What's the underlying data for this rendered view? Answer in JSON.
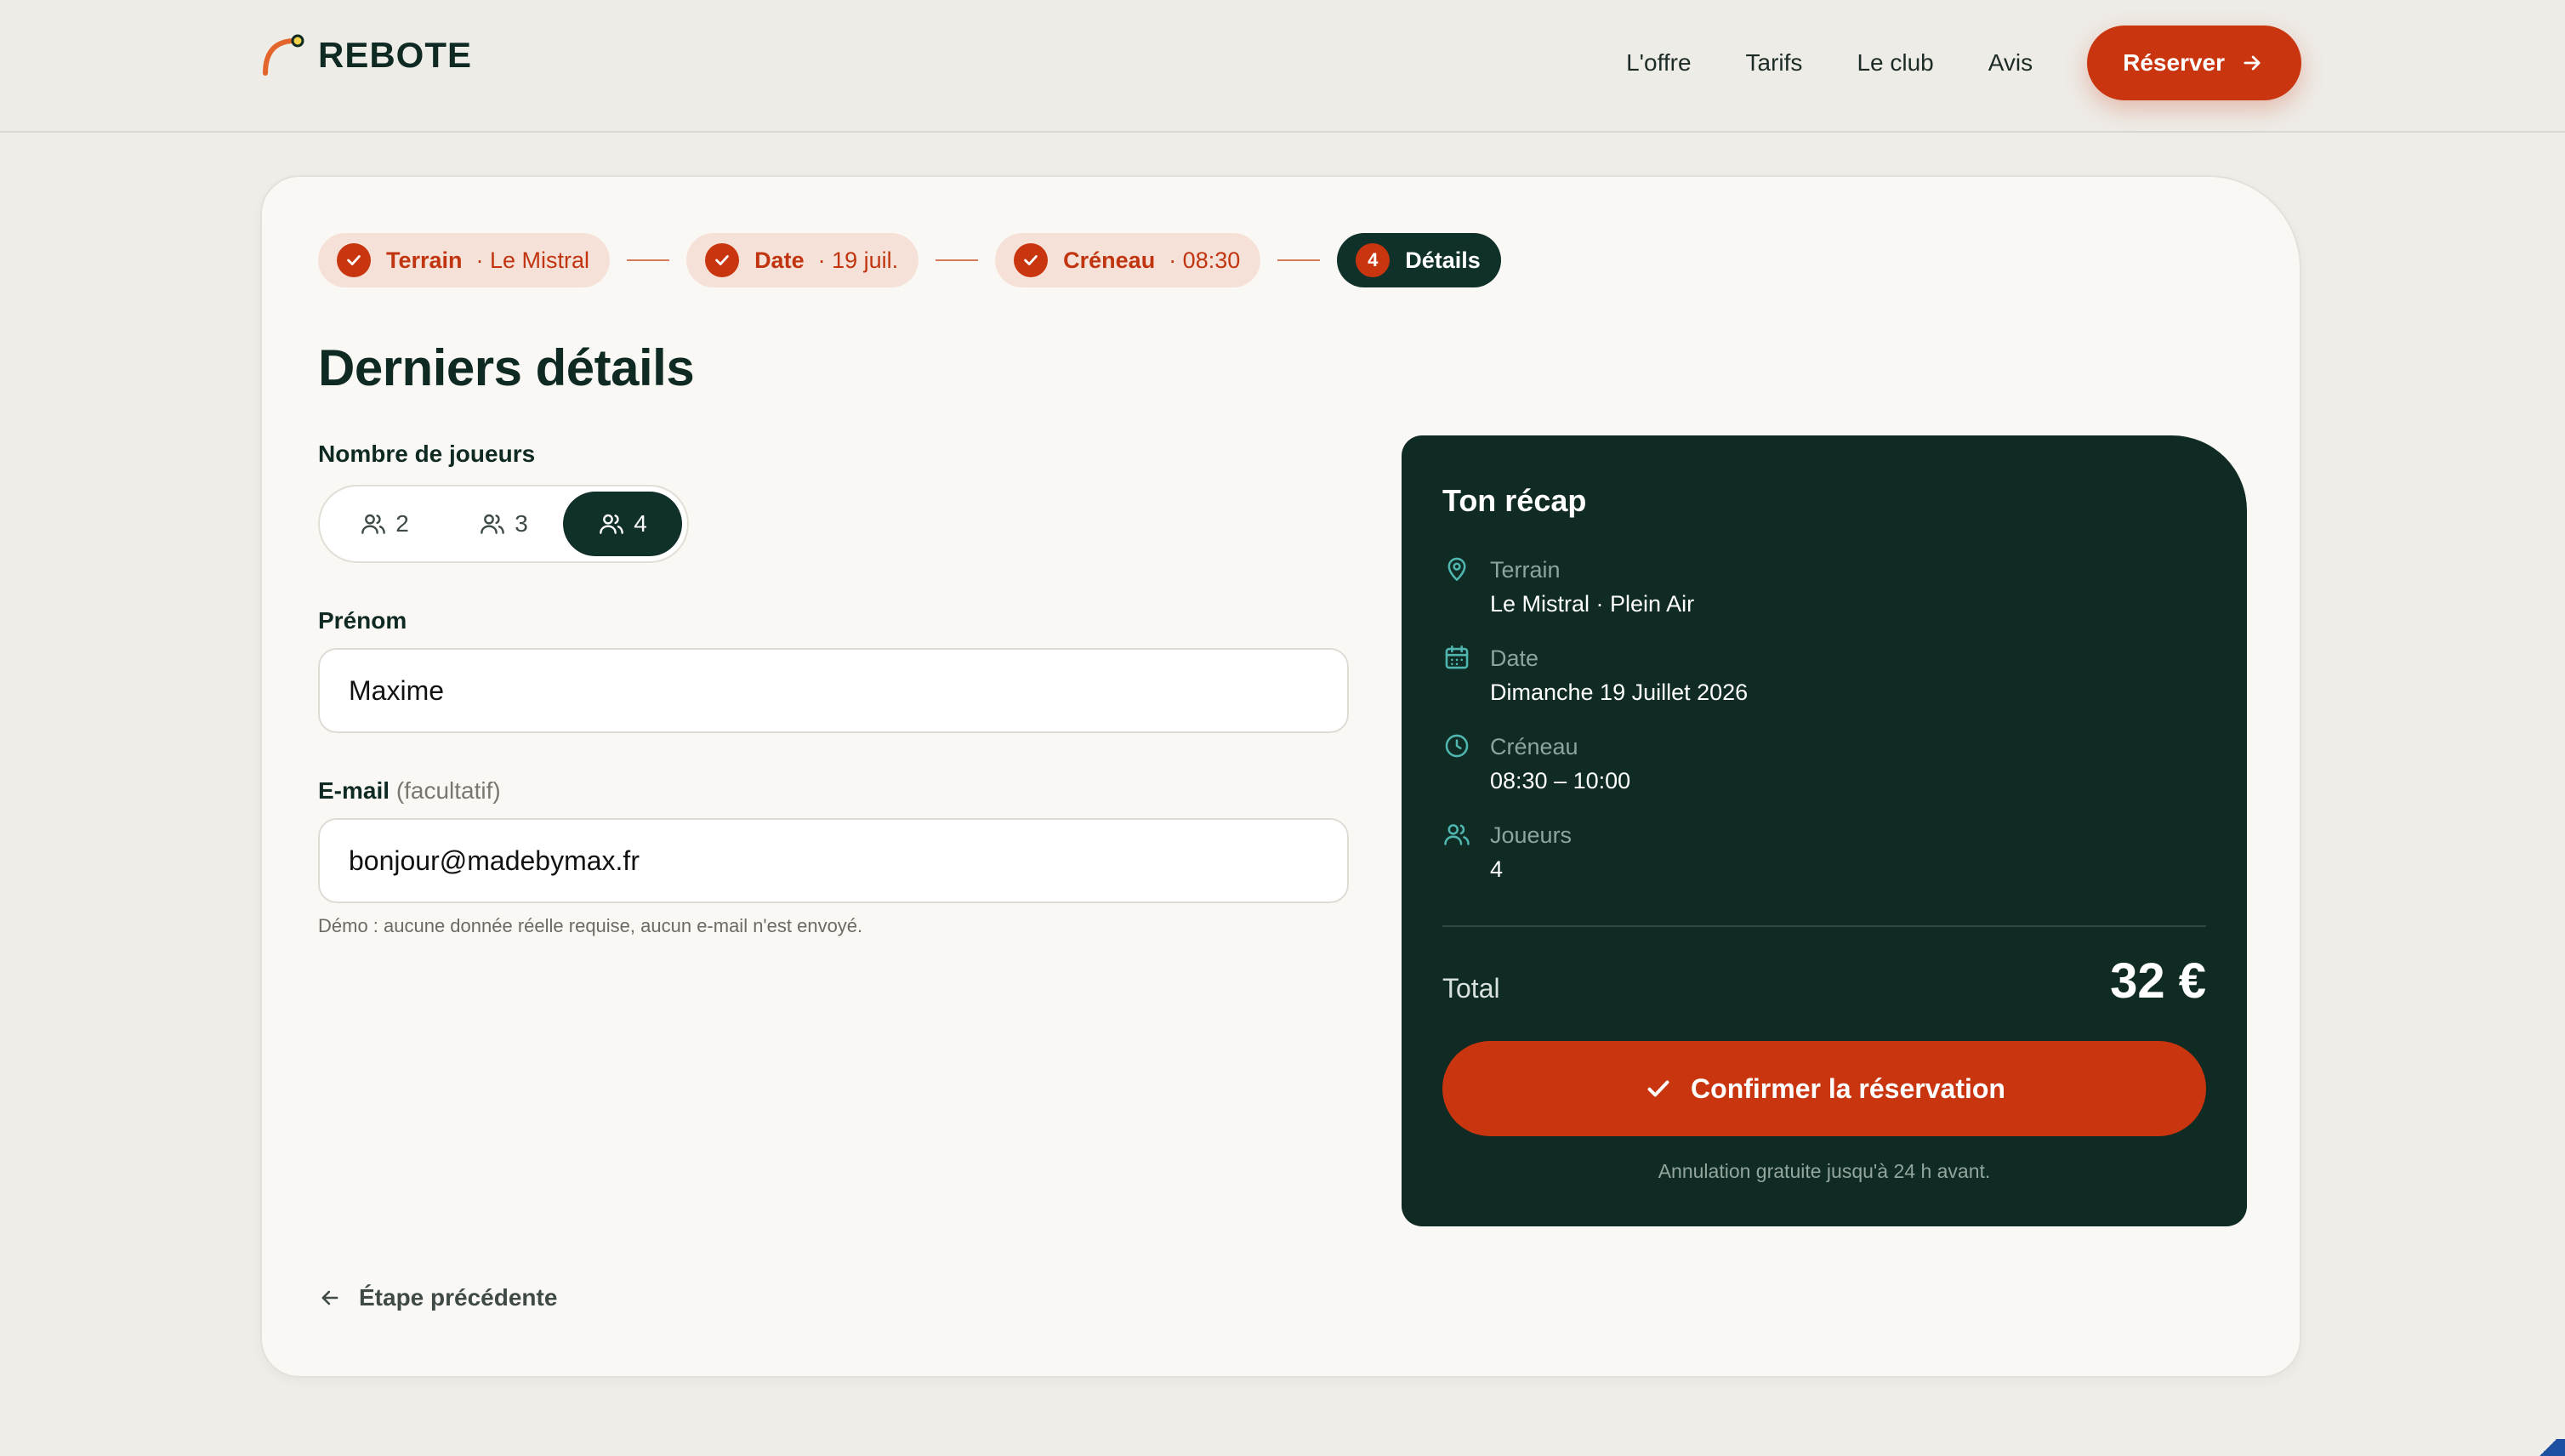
{
  "header": {
    "logo_text": "REBOTE",
    "nav": [
      "L'offre",
      "Tarifs",
      "Le club",
      "Avis"
    ],
    "cta_label": "Réserver"
  },
  "steps": [
    {
      "label": "Terrain",
      "meta": "· Le Mistral",
      "status": "done"
    },
    {
      "label": "Date",
      "meta": "· 19 juil.",
      "status": "done"
    },
    {
      "label": "Créneau",
      "meta": "· 08:30",
      "status": "done"
    },
    {
      "number": "4",
      "label": "Détails",
      "status": "active"
    }
  ],
  "main": {
    "title": "Derniers détails",
    "players_label": "Nombre de joueurs",
    "player_options": [
      "2",
      "3",
      "4"
    ],
    "selected_players": "4",
    "firstname_label": "Prénom",
    "firstname_value": "Maxime",
    "email_label": "E-mail",
    "email_optional": "(facultatif)",
    "email_value": "bonjour@madebymax.fr",
    "hint": "Démo : aucune donnée réelle requise, aucun e-mail n'est envoyé.",
    "back_label": "Étape précédente"
  },
  "recap": {
    "title": "Ton récap",
    "items": [
      {
        "icon": "map-pin-icon",
        "label": "Terrain",
        "value": "Le Mistral · Plein Air"
      },
      {
        "icon": "calendar-icon",
        "label": "Date",
        "value": "Dimanche 19 Juillet 2026"
      },
      {
        "icon": "clock-icon",
        "label": "Créneau",
        "value": "08:30 – 10:00"
      },
      {
        "icon": "users-icon",
        "label": "Joueurs",
        "value": "4"
      }
    ],
    "total_label": "Total",
    "total_value": "32 €",
    "confirm_label": "Confirmer la réservation",
    "cancel_note": "Annulation gratuite jusqu'à 24 h avant."
  },
  "colors": {
    "accent": "#c8350f",
    "dark": "#0f2b24",
    "background": "#efede8",
    "icon_teal": "#4fb6b0"
  }
}
